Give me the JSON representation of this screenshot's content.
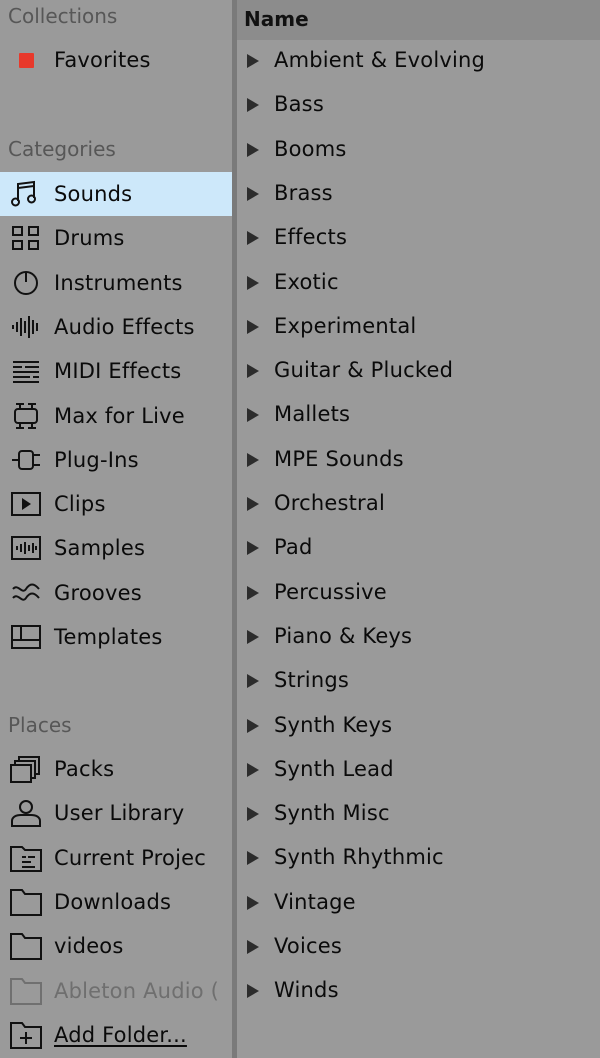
{
  "sidebar": {
    "collections_header": "Collections",
    "favorites": {
      "label": "Favorites",
      "color": "#e8392b"
    },
    "categories_header": "Categories",
    "categories": [
      {
        "label": "Sounds",
        "icon": "music-note-icon",
        "selected": true
      },
      {
        "label": "Drums",
        "icon": "drum-grid-icon"
      },
      {
        "label": "Instruments",
        "icon": "power-knob-icon"
      },
      {
        "label": "Audio Effects",
        "icon": "waveform-icon"
      },
      {
        "label": "MIDI Effects",
        "icon": "midi-lines-icon"
      },
      {
        "label": "Max for Live",
        "icon": "max-device-icon"
      },
      {
        "label": "Plug-Ins",
        "icon": "plug-icon"
      },
      {
        "label": "Clips",
        "icon": "clip-play-icon"
      },
      {
        "label": "Samples",
        "icon": "sample-wave-icon"
      },
      {
        "label": "Grooves",
        "icon": "groove-wave-icon"
      },
      {
        "label": "Templates",
        "icon": "template-icon"
      }
    ],
    "places_header": "Places",
    "places": [
      {
        "label": "Packs",
        "icon": "packs-icon"
      },
      {
        "label": "User Library",
        "icon": "user-icon"
      },
      {
        "label": "Current Projec",
        "icon": "project-folder-icon"
      },
      {
        "label": "Downloads",
        "icon": "folder-icon"
      },
      {
        "label": "videos",
        "icon": "folder-icon"
      },
      {
        "label": "Ableton Audio (",
        "icon": "folder-icon",
        "dim": true
      },
      {
        "label": "Add Folder...",
        "icon": "add-folder-icon",
        "underline": true
      }
    ]
  },
  "main": {
    "column_header": "Name",
    "items": [
      "Ambient & Evolving",
      "Bass",
      "Booms",
      "Brass",
      "Effects",
      "Exotic",
      "Experimental",
      "Guitar & Plucked",
      "Mallets",
      "MPE Sounds",
      "Orchestral",
      "Pad",
      "Percussive",
      "Piano & Keys",
      "Strings",
      "Synth Keys",
      "Synth Lead",
      "Synth Misc",
      "Synth Rhythmic",
      "Vintage",
      "Voices",
      "Winds"
    ]
  },
  "colors": {
    "background": "#9a9a9a",
    "selected": "#cde8fa",
    "header_text": "#575757",
    "accent_red": "#e8392b"
  }
}
